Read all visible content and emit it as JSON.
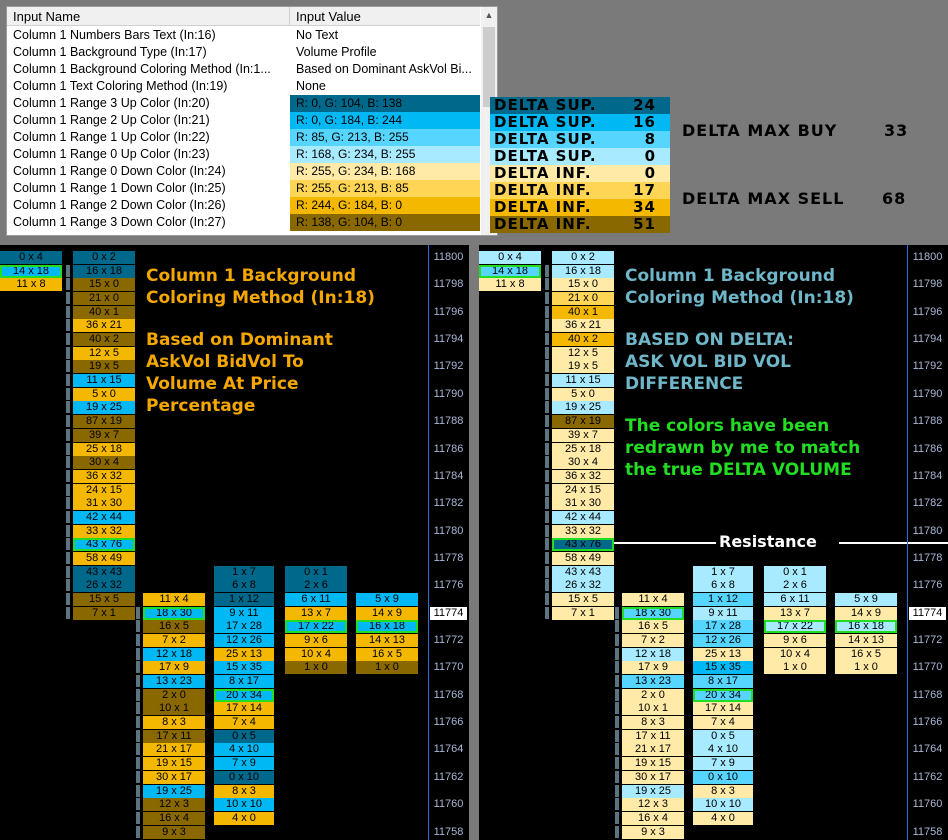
{
  "settings": {
    "header": {
      "name": "Input Name",
      "value": "Input Value"
    },
    "rows": [
      {
        "name": "Column 1 Numbers Bars Text  (In:16)",
        "value": "No Text"
      },
      {
        "name": "Column 1 Background Type  (In:17)",
        "value": "Volume Profile"
      },
      {
        "name": "Column 1 Background Coloring Method  (In:1...",
        "value": "Based on Dominant AskVol Bi..."
      },
      {
        "name": "Column 1 Text Coloring Method  (In:19)",
        "value": "None"
      },
      {
        "name": "Column 1 Range 3 Up Color  (In:20)",
        "value": "R: 0, G: 104, B: 138",
        "color": "#00688a"
      },
      {
        "name": "Column 1 Range 2 Up Color  (In:21)",
        "value": "R: 0, G: 184, B: 244",
        "color": "#00b8f4"
      },
      {
        "name": "Column 1 Range 1 Up Color  (In:22)",
        "value": "R: 85, G: 213, B: 255",
        "color": "#55d5ff"
      },
      {
        "name": "Column 1 Range 0 Up Color  (In:23)",
        "value": "R: 168, G: 234, B: 255",
        "color": "#a8eaff"
      },
      {
        "name": "Column 1 Range 0 Down Color  (In:24)",
        "value": "R: 255, G: 234, B: 168",
        "color": "#ffeaa8"
      },
      {
        "name": "Column 1 Range 1 Down Color  (In:25)",
        "value": "R: 255, G: 213, B: 85",
        "color": "#ffd555"
      },
      {
        "name": "Column 1 Range 2 Down Color  (In:26)",
        "value": "R: 244, G: 184, B: 0",
        "color": "#f4b800"
      },
      {
        "name": "Column 1 Range 3 Down Color  (In:27)",
        "value": "R: 138, G: 104, B: 0",
        "color": "#8a6800"
      }
    ]
  },
  "legend": [
    {
      "label": "DELTA SUP.",
      "value": "24"
    },
    {
      "label": "DELTA SUP.",
      "value": "16"
    },
    {
      "label": "DELTA SUP.",
      "value": "8"
    },
    {
      "label": "DELTA SUP.",
      "value": "0"
    },
    {
      "label": "DELTA INF.",
      "value": "0"
    },
    {
      "label": "DELTA INF.",
      "value": "17"
    },
    {
      "label": "DELTA INF.",
      "value": "34"
    },
    {
      "label": "DELTA INF.",
      "value": "51"
    }
  ],
  "max_buy": {
    "label": "DELTA MAX BUY",
    "value": "33"
  },
  "max_sell": {
    "label": "DELTA MAX SELL",
    "value": "68"
  },
  "palette": {
    "up3": "#00688a",
    "up2": "#00b8f4",
    "up1": "#55d5ff",
    "up0": "#a8eaff",
    "dn0": "#ffeaa8",
    "dn1": "#ffd555",
    "dn2": "#f4b800",
    "dn3": "#8a6800",
    "orange_text": "#f4a700",
    "teal_text": "#6fb6c8",
    "green_text": "#22dd22"
  },
  "price_axis": {
    "ticks": [
      "11800",
      "11798",
      "11796",
      "11794",
      "11792",
      "11790",
      "11788",
      "11786",
      "11784",
      "11782",
      "11780",
      "11778",
      "11776",
      "11774",
      "11772",
      "11770",
      "11768",
      "11766",
      "11764",
      "11762",
      "11760",
      "11758"
    ],
    "current": "11774"
  },
  "left_panel": {
    "note1": "Column 1 Background\nColoring Method (In:18)",
    "note2": "Based on Dominant\nAskVol BidVol To\nVolume At Price\nPercentage"
  },
  "right_panel": {
    "note1": "Column 1 Background\nColoring Method (In:18)",
    "note2": "BASED ON DELTA:\nASK VOL BID VOL\nDIFFERENCE",
    "note3": "The colors have been\nredrawn by me to match\nthe true DELTA VOLUME",
    "resistance": "Resistance"
  },
  "columns": [
    {
      "start": 0,
      "cells": [
        {
          "t": "0 x 4",
          "l": "up3",
          "r": "up0"
        },
        {
          "t": "14 x 18",
          "l": "up2",
          "r": "up1",
          "hl": true
        },
        {
          "t": "11 x 8",
          "l": "dn2",
          "r": "dn0"
        }
      ]
    },
    {
      "start": 0,
      "bars": true,
      "cells": [
        {
          "t": "0 x 2",
          "l": "up3",
          "r": "up0"
        },
        {
          "t": "16 x 18",
          "l": "up3",
          "r": "up0"
        },
        {
          "t": "15 x 0",
          "l": "dn3",
          "r": "dn0"
        },
        {
          "t": "21 x 0",
          "l": "dn3",
          "r": "dn1"
        },
        {
          "t": "40 x 1",
          "l": "dn3",
          "r": "dn2"
        },
        {
          "t": "36 x 21",
          "l": "dn2",
          "r": "dn0"
        },
        {
          "t": "40 x 2",
          "l": "dn3",
          "r": "dn2"
        },
        {
          "t": "12 x 5",
          "l": "dn2",
          "r": "dn0"
        },
        {
          "t": "19 x 5",
          "l": "dn3",
          "r": "dn0"
        },
        {
          "t": "11 x 15",
          "l": "up2",
          "r": "up0"
        },
        {
          "t": "5 x 0",
          "l": "dn2",
          "r": "dn0"
        },
        {
          "t": "19 x 25",
          "l": "up2",
          "r": "up0"
        },
        {
          "t": "87 x 19",
          "l": "dn3",
          "r": "dn3"
        },
        {
          "t": "39 x 7",
          "l": "dn3",
          "r": "dn0"
        },
        {
          "t": "25 x 18",
          "l": "dn2",
          "r": "dn0"
        },
        {
          "t": "30 x 4",
          "l": "dn3",
          "r": "dn0"
        },
        {
          "t": "36 x 32",
          "l": "dn2",
          "r": "dn0"
        },
        {
          "t": "24 x 15",
          "l": "dn2",
          "r": "dn0"
        },
        {
          "t": "31 x 30",
          "l": "dn2",
          "r": "dn0"
        },
        {
          "t": "42 x 44",
          "l": "up2",
          "r": "up0"
        },
        {
          "t": "33 x 32",
          "l": "dn2",
          "r": "dn0"
        },
        {
          "t": "43 x 76",
          "l": "up2",
          "r": "up3",
          "hl": true
        },
        {
          "t": "58 x 49",
          "l": "dn2",
          "r": "dn0"
        },
        {
          "t": "43 x 43",
          "l": "up3",
          "r": "up0"
        },
        {
          "t": "26 x 32",
          "l": "up3",
          "r": "up0"
        },
        {
          "t": "15 x 5",
          "l": "dn3",
          "r": "dn0"
        },
        {
          "t": "7 x 1",
          "l": "dn3",
          "r": "dn0"
        }
      ]
    },
    {
      "start": 25,
      "bars": true,
      "cells": [
        {
          "t": "11 x 4",
          "l": "dn2",
          "r": "dn0"
        },
        {
          "t": "18 x 30",
          "l": "up2",
          "r": "up1",
          "hl": true
        },
        {
          "t": "16 x 5",
          "l": "dn3",
          "r": "dn0"
        },
        {
          "t": "7 x 2",
          "l": "dn2",
          "r": "dn0"
        },
        {
          "t": "12 x 18",
          "l": "up2",
          "r": "up0"
        },
        {
          "t": "17 x 9",
          "l": "dn2",
          "r": "dn0"
        },
        {
          "t": "13 x 23",
          "l": "up2",
          "r": "up1"
        },
        {
          "t": "2 x 0",
          "l": "dn3",
          "r": "dn0"
        },
        {
          "t": "10 x 1",
          "l": "dn3",
          "r": "dn0"
        },
        {
          "t": "8 x 3",
          "l": "dn2",
          "r": "dn0"
        },
        {
          "t": "17 x 11",
          "l": "dn3",
          "r": "dn0"
        },
        {
          "t": "21 x 17",
          "l": "dn2",
          "r": "dn0"
        },
        {
          "t": "19 x 15",
          "l": "dn2",
          "r": "dn0"
        },
        {
          "t": "30 x 17",
          "l": "dn2",
          "r": "dn0"
        },
        {
          "t": "19 x 25",
          "l": "up2",
          "r": "up0"
        },
        {
          "t": "12 x 3",
          "l": "dn3",
          "r": "dn0"
        },
        {
          "t": "16 x 4",
          "l": "dn3",
          "r": "dn0"
        },
        {
          "t": "9 x 3",
          "l": "dn3",
          "r": "dn0"
        }
      ]
    },
    {
      "start": 23,
      "cells": [
        {
          "t": "1 x 7",
          "l": "up3",
          "r": "up0"
        },
        {
          "t": "6 x 8",
          "l": "up3",
          "r": "up0"
        },
        {
          "t": "1 x 12",
          "l": "up3",
          "r": "up1"
        },
        {
          "t": "9 x 11",
          "l": "up2",
          "r": "up0"
        },
        {
          "t": "17 x 28",
          "l": "up2",
          "r": "up1"
        },
        {
          "t": "12 x 26",
          "l": "up2",
          "r": "up1"
        },
        {
          "t": "25 x 13",
          "l": "dn2",
          "r": "dn0"
        },
        {
          "t": "15 x 35",
          "l": "up2",
          "r": "up2"
        },
        {
          "t": "8 x 17",
          "l": "up2",
          "r": "up1"
        },
        {
          "t": "20 x 34",
          "l": "up2",
          "r": "up1",
          "hl": true
        },
        {
          "t": "17 x 14",
          "l": "dn2",
          "r": "dn0"
        },
        {
          "t": "7 x 4",
          "l": "dn2",
          "r": "dn0"
        },
        {
          "t": "0 x 5",
          "l": "up3",
          "r": "up0"
        },
        {
          "t": "4 x 10",
          "l": "up2",
          "r": "up0"
        },
        {
          "t": "7 x 9",
          "l": "up2",
          "r": "up0"
        },
        {
          "t": "0 x 10",
          "l": "up3",
          "r": "up1"
        },
        {
          "t": "8 x 3",
          "l": "dn2",
          "r": "dn0"
        },
        {
          "t": "10 x 10",
          "l": "up2",
          "r": "up0"
        },
        {
          "t": "4 x 0",
          "l": "dn2",
          "r": "dn0"
        }
      ]
    },
    {
      "start": 23,
      "cells": [
        {
          "t": "0 x 1",
          "l": "up3",
          "r": "up0"
        },
        {
          "t": "2 x 6",
          "l": "up3",
          "r": "up0"
        },
        {
          "t": "6 x 11",
          "l": "up2",
          "r": "up0"
        },
        {
          "t": "13 x 7",
          "l": "dn2",
          "r": "dn0"
        },
        {
          "t": "17 x 22",
          "l": "up2",
          "r": "up0",
          "hl": true
        },
        {
          "t": "9 x 6",
          "l": "dn2",
          "r": "dn0"
        },
        {
          "t": "10 x 4",
          "l": "dn2",
          "r": "dn0"
        },
        {
          "t": "1 x 0",
          "l": "dn3",
          "r": "dn0"
        }
      ]
    },
    {
      "start": 25,
      "cells": [
        {
          "t": "5 x 9",
          "l": "up2",
          "r": "up0"
        },
        {
          "t": "14 x 9",
          "l": "dn2",
          "r": "dn0"
        },
        {
          "t": "16 x 18",
          "l": "up2",
          "r": "up0",
          "hl": true
        },
        {
          "t": "14 x 13",
          "l": "dn2",
          "r": "dn0"
        },
        {
          "t": "16 x 5",
          "l": "dn2",
          "r": "dn0"
        },
        {
          "t": "1 x 0",
          "l": "dn3",
          "r": "dn0"
        }
      ]
    }
  ]
}
